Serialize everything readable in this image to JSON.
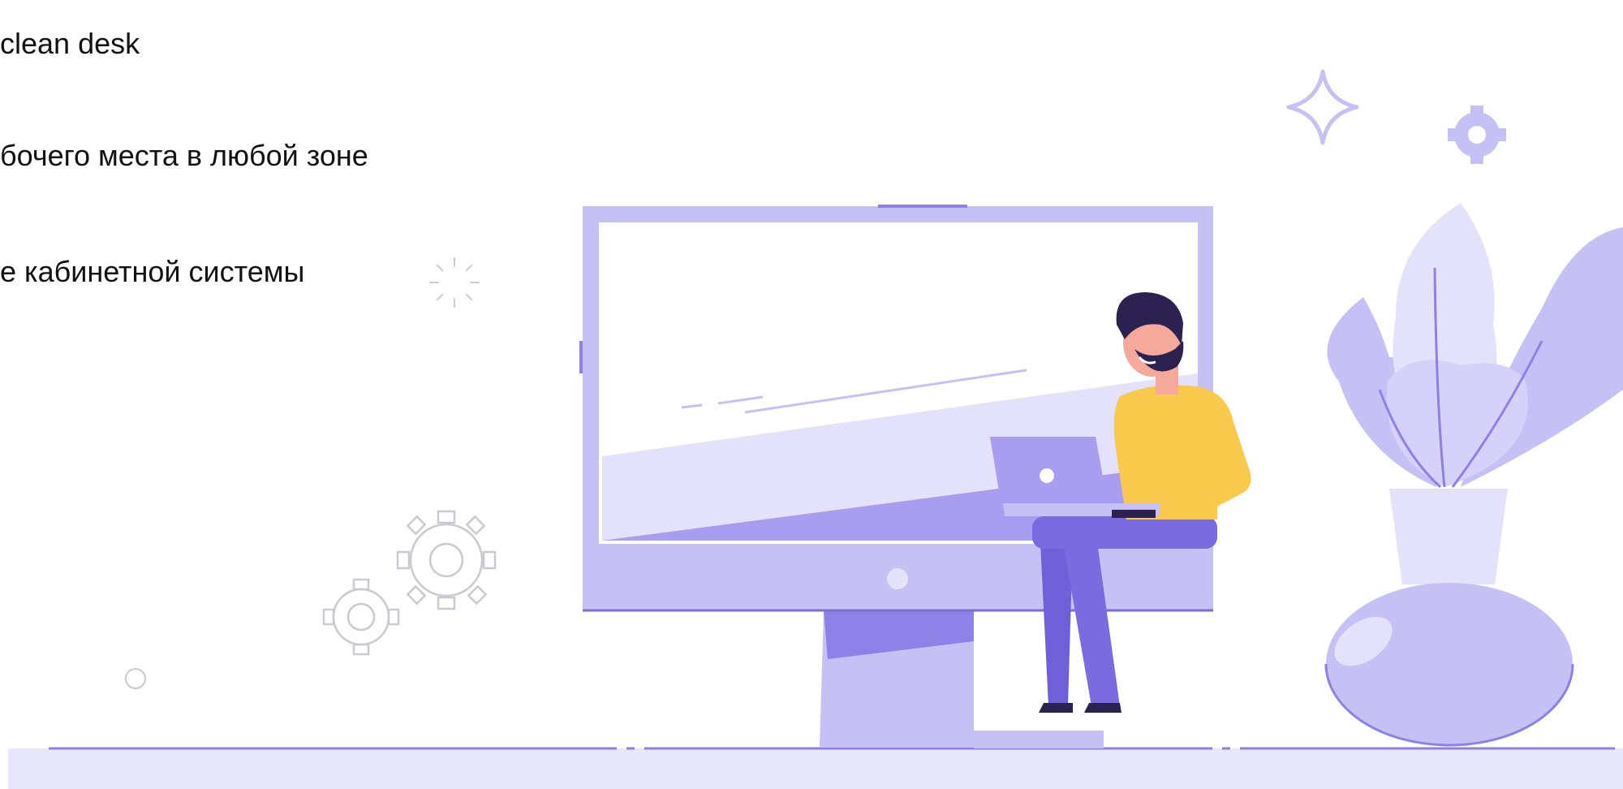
{
  "text_lines": [
    "clean desk",
    "бочего места в любой зоне",
    "е кабинетной системы"
  ],
  "illustration": {
    "subject": "man-with-laptop-sitting-on-monitor",
    "colors": {
      "lavender_light": "#e4e2fb",
      "lavender": "#c6c1f5",
      "violet": "#8d80e6",
      "violet_dark": "#6f5fd8",
      "outline": "#7a6fcf",
      "shirt_yellow": "#f8c94a",
      "skin": "#f4a99a",
      "hair": "#2b2250",
      "decor_grey": "#d0d0d6"
    }
  }
}
